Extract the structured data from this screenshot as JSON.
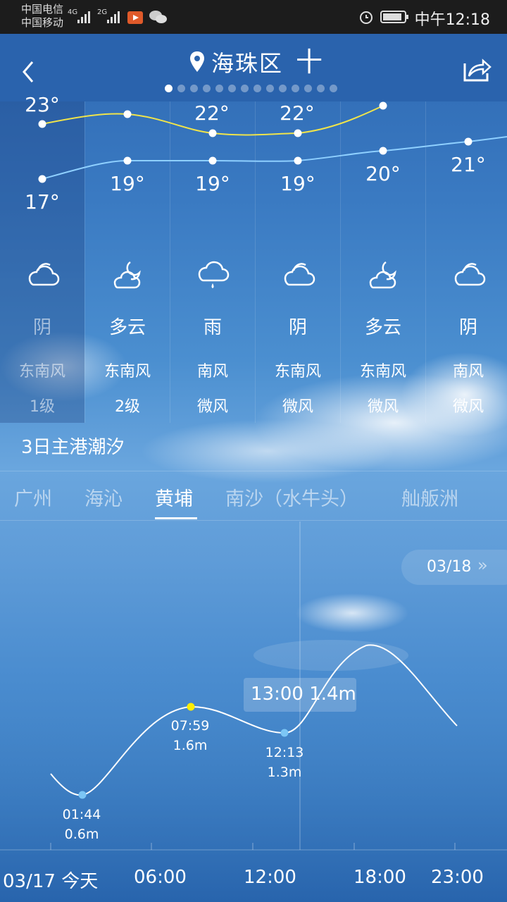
{
  "status_bar": {
    "carrier1": "中国电信",
    "carrier2": "中国移动",
    "net1": "4G",
    "net2": "2G",
    "time": "中午12:18"
  },
  "header": {
    "location": "海珠区",
    "add_symbol": "十",
    "page_count": 14,
    "active_page": 0
  },
  "forecast": {
    "high_temps": [
      "23°",
      "",
      "22°",
      "22°",
      "",
      ""
    ],
    "low_temps": [
      "17°",
      "19°",
      "19°",
      "19°",
      "20°",
      "21°"
    ],
    "days": [
      {
        "icon": "cloudy-icon",
        "desc": "阴",
        "wind": "东南风",
        "level": "1级"
      },
      {
        "icon": "partly-cloudy-night-icon",
        "desc": "多云",
        "wind": "东南风",
        "level": "2级"
      },
      {
        "icon": "rain-icon",
        "desc": "雨",
        "wind": "南风",
        "level": "微风"
      },
      {
        "icon": "cloudy-icon",
        "desc": "阴",
        "wind": "东南风",
        "level": "微风"
      },
      {
        "icon": "partly-cloudy-night-icon",
        "desc": "多云",
        "wind": "东南风",
        "level": "微风"
      },
      {
        "icon": "cloudy-icon",
        "desc": "阴",
        "wind": "南风",
        "level": "微风"
      }
    ]
  },
  "tide": {
    "title": "3日主港潮汐",
    "tabs": [
      "广州",
      "海沁",
      "黄埔",
      "南沙（水牛头）",
      "舢舨洲"
    ],
    "active_tab": 2,
    "next_date": "03/18",
    "tooltip": "13:00 1.4m",
    "points": [
      {
        "time": "01:44",
        "height": "0.6m",
        "type": "low"
      },
      {
        "time": "07:59",
        "height": "1.6m",
        "type": "high"
      },
      {
        "time": "12:13",
        "height": "1.3m",
        "type": "low"
      }
    ],
    "x_labels": [
      "03/17 今天",
      "06:00",
      "12:00",
      "18:00",
      "23:00"
    ]
  },
  "colors": {
    "header_bg": "#2a63ad",
    "high_line": "#f0e44a",
    "low_line": "#8fd0ff",
    "low_point": "#7cc6f5",
    "high_point": "#ffee00"
  }
}
